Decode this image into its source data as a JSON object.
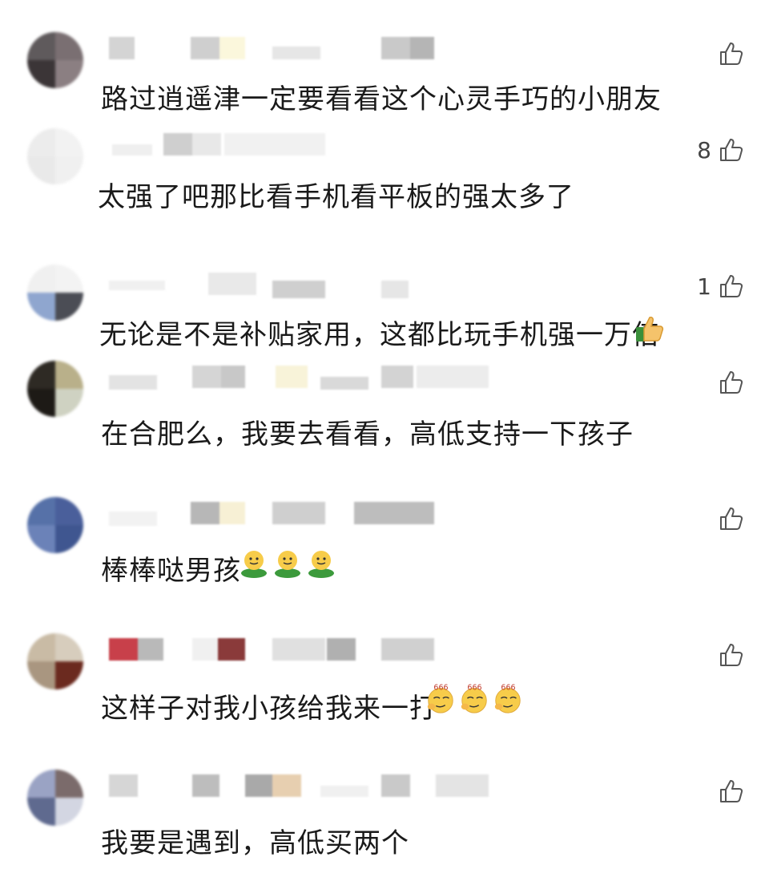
{
  "comments": [
    {
      "text": "路过逍遥津一定要看看这个心灵手巧的小朋友",
      "likes": "",
      "avatar": [
        "#5f5a5c",
        "#7a6f72",
        "#3b3537",
        "#8b7f82"
      ],
      "name_blocks": [
        "#d4d4d4",
        "#cfcfcf",
        "#fbf7dc",
        "#c9c9c9",
        "#e6e6e6",
        "#b5b5b5"
      ]
    },
    {
      "text": "太强了吧那比看手机看平板的强太多了",
      "likes": "8",
      "avatar": [
        "#ececec",
        "#f2f2f2",
        "#e9e9e9",
        "#f0f0f0"
      ],
      "name_blocks": [
        "#efefef",
        "#cfcfcf",
        "#e8e8e8",
        "#f1f1f1"
      ]
    },
    {
      "text": "无论是不是补贴家用，这都比玩手机强一万倍",
      "likes": "1",
      "avatar": [
        "#f0f0f0",
        "#f3f3f3",
        "#8fa6cf",
        "#4b4d55"
      ],
      "name_blocks": [
        "#f0f0f0",
        "#e9e9e9",
        "#cfcfcf",
        "#e6e6e6"
      ]
    },
    {
      "text": "在合肥么，我要去看看，高低支持一下孩子",
      "likes": "",
      "avatar": [
        "#2e2a24",
        "#b9b08a",
        "#1d1a16",
        "#cfd2c2"
      ],
      "name_blocks": [
        "#e3e3e3",
        "#c8c8c8",
        "#f8f3d9",
        "#d9d9d9",
        "#d3d3d3",
        "#ececec"
      ]
    },
    {
      "text": "棒棒哒男孩",
      "likes": "",
      "avatar": [
        "#5671a8",
        "#4a5f9b",
        "#6b82b8",
        "#3f5690"
      ],
      "name_blocks": [
        "#f2f2f2",
        "#b7b7b7",
        "#f7f0d5",
        "#cfcfcf",
        "#bdbdbd"
      ]
    },
    {
      "text": "这样子对我小孩给我来一打",
      "likes": "",
      "avatar": [
        "#c9bba5",
        "#d7cdbd",
        "#a99680",
        "#6b2a1f"
      ],
      "name_blocks": [
        "#c8404a",
        "#b9b9b9",
        "#f0f0f0",
        "#8a3a3a",
        "#e0e0e0",
        "#b0b0b0",
        "#d0d0d0"
      ]
    },
    {
      "text": "我要是遇到，高低买两个",
      "likes": "",
      "avatar": [
        "#9aa3c4",
        "#7b6b6b",
        "#5f6a8f",
        "#d3d6e2"
      ],
      "name_blocks": [
        "#d6d6d6",
        "#bdbdbd",
        "#a9a9a9",
        "#e7cfb0",
        "#f0f0f0",
        "#c9c9c9"
      ]
    }
  ],
  "icons": {
    "like": "thumbs-up-icon",
    "thumbs_emoji": "thumbs-up-emoji",
    "hug_emoji": "green-hug-emoji",
    "smirk_emoji": "666-smirk-emoji"
  },
  "emoji_labels": {
    "smirk": "666"
  }
}
